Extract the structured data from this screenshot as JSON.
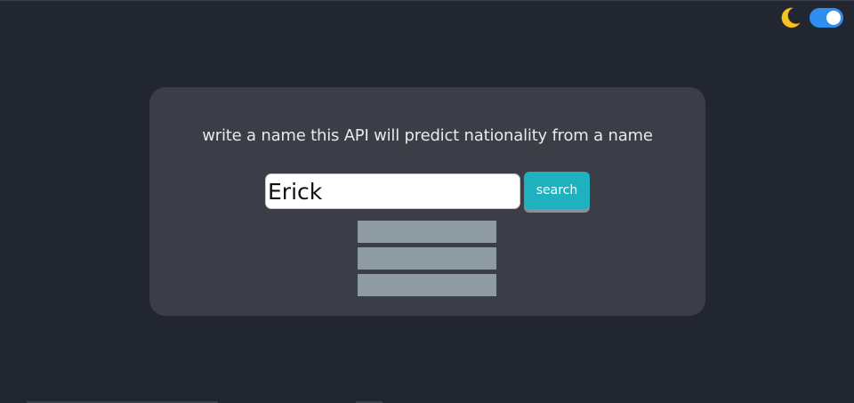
{
  "theme_toggle": {
    "icon": "moon-icon",
    "state": "dark-on",
    "accent_color": "#2f8ff0"
  },
  "main": {
    "prompt": "write a name this API will predict nationality from a name",
    "name_input": {
      "value": "Erick",
      "placeholder": ""
    },
    "search_button": {
      "label": "search",
      "color": "#1fb1bf"
    },
    "results": {
      "placeholder_count": 3,
      "placeholder_color": "#8e9ba2"
    }
  }
}
